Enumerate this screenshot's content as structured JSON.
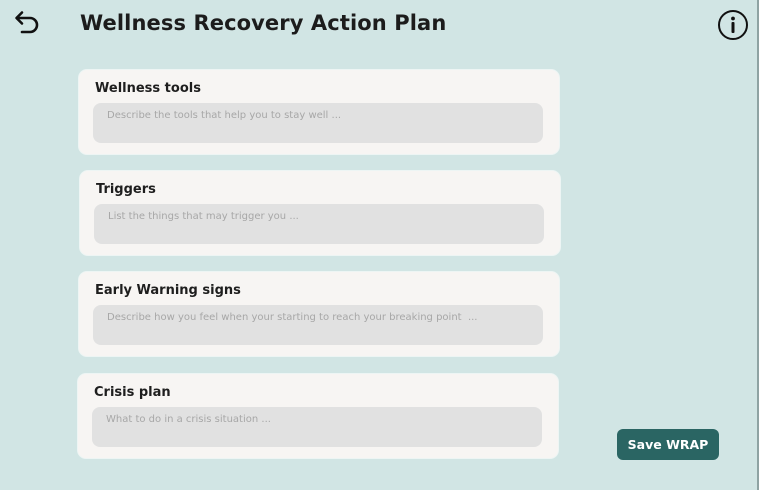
{
  "header": {
    "title": "Wellness Recovery Action Plan",
    "back_icon": "undo-arrow-icon",
    "info_icon": "info-circle-icon"
  },
  "sections": [
    {
      "label": "Wellness tools",
      "placeholder": "Describe the tools that help you to stay well ...",
      "value": ""
    },
    {
      "label": "Triggers",
      "placeholder": "List the things that may trigger you ...",
      "value": ""
    },
    {
      "label": "Early Warning signs",
      "placeholder": "Describe how you feel when your starting to reach your breaking point  ...",
      "value": ""
    },
    {
      "label": "Crisis plan",
      "placeholder": "What to do in a crisis situation ...",
      "value": ""
    }
  ],
  "actions": {
    "save_label": "Save WRAP"
  },
  "colors": {
    "background": "#d1e5e4",
    "card": "#f7f5f3",
    "input": "#e1e1e1",
    "accent": "#2a6563"
  }
}
